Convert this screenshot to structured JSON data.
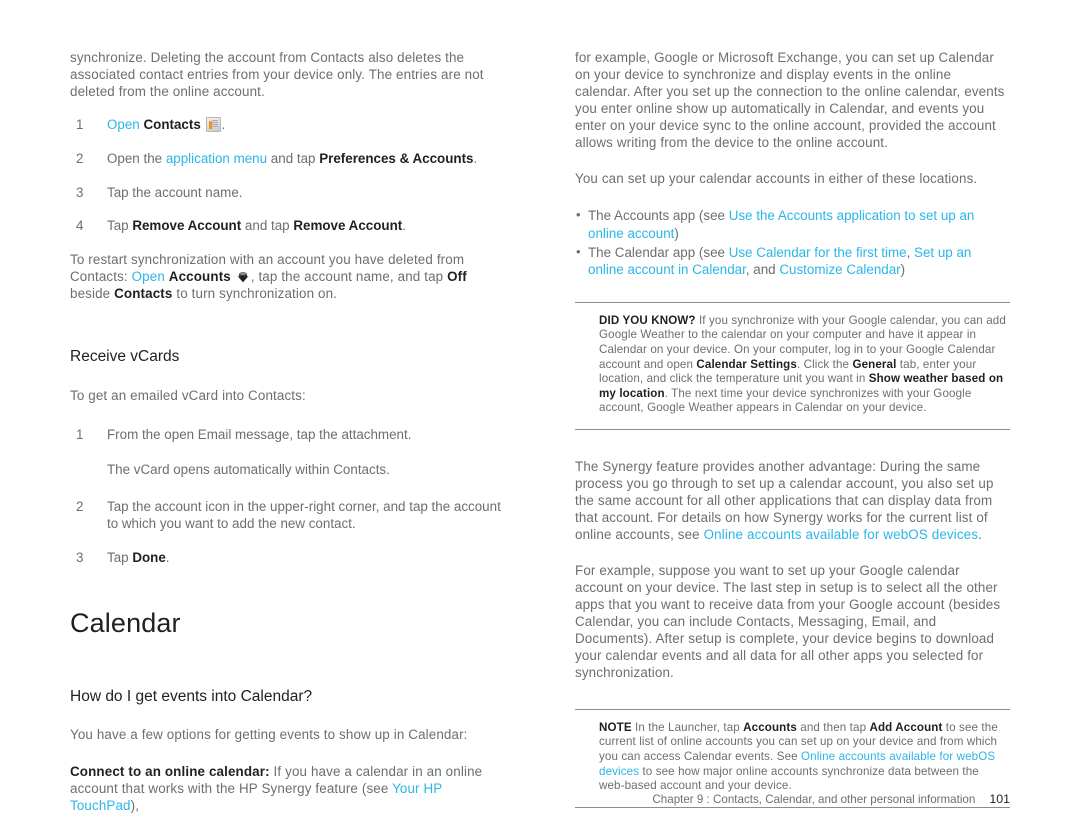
{
  "document": {
    "kind": "hp-touchpad-user-guide-page",
    "page_number": "101"
  },
  "colors": {
    "link": "#2bb6e8",
    "body_text": "#6d6e71",
    "bold_text": "#231f20",
    "icon_accent": "#f6921e",
    "rule": "#8a8c8e"
  },
  "left_column": {
    "intro_paragraph": "synchronize. Deleting the account from Contacts also deletes the associated contact entries from your device only. The entries are not deleted from the online account.",
    "remove_steps": [
      {
        "num": "1",
        "prefix_link": "Open",
        "bold": "Contacts",
        "icon": "contacts-icon",
        "suffix": "."
      },
      {
        "num": "2",
        "text_before_link": "Open the ",
        "link": "application menu",
        "text_middle": " and tap ",
        "bold": "Preferences & Accounts",
        "suffix": "."
      },
      {
        "num": "3",
        "plain": "Tap the account name."
      },
      {
        "num": "4",
        "text_before": "Tap ",
        "bold1": "Remove Account",
        "text_middle": " and tap ",
        "bold2": "Remove Account",
        "suffix": "."
      }
    ],
    "restart_paragraph": {
      "part1": "To restart synchronization with an account you have deleted from Contacts: ",
      "link": "Open",
      "part2": " ",
      "bold1": "Accounts",
      "icon": "accounts-icon",
      "part3": ", tap the account name, and tap ",
      "bold2": "Off",
      "part4": " beside ",
      "bold3": "Contacts",
      "part5": " to turn synchronization on."
    },
    "receive_vcards": {
      "heading": "Receive vCards",
      "lead": "To get an emailed vCard into Contacts:",
      "steps": [
        {
          "num": "1",
          "plain": "From the open Email message, tap the attachment."
        },
        {
          "sub": "The vCard opens automatically within Contacts."
        },
        {
          "num": "2",
          "plain": "Tap the account icon in the upper-right corner, and tap the account to which you want to add the new contact."
        },
        {
          "num": "3",
          "text_before": "Tap ",
          "bold": "Done",
          "suffix": "."
        }
      ]
    },
    "calendar_section": {
      "heading": "Calendar",
      "subheading": "How do I get events into Calendar?",
      "lead": "You have a few options for getting events to show up in Calendar:",
      "connect_para": {
        "bold_lead": "Connect to an online calendar:",
        "part1": " If you have a calendar in an online account that works with the HP Synergy feature (see ",
        "link": "Your HP TouchPad",
        "part2": "),"
      }
    }
  },
  "right_column": {
    "continued_paragraph": "for example, Google or Microsoft Exchange, you can set up Calendar on your device to synchronize and display events in the online calendar. After you set up the connection to the online calendar, events you enter online show up automatically in Calendar, and events you enter on your device sync to the online account, provided the account allows writing from the device to the online account.",
    "locations_lead": "You can set up your calendar accounts in either of these locations.",
    "location_bullets": [
      {
        "part1": "The Accounts app (see ",
        "link": "Use the Accounts application to set up an online account",
        "part2": ")"
      },
      {
        "part1": "The Calendar app (see ",
        "link1": "Use Calendar for the first time",
        "mid1": ", ",
        "link2": "Set up an online account in Calendar",
        "mid2": ", and ",
        "link3": "Customize Calendar",
        "part2": ")"
      }
    ],
    "did_you_know_callout": {
      "tag": "DID YOU KNOW?",
      "part1": " If you synchronize with your Google calendar, you can add Google Weather to the calendar on your computer and have it appear in Calendar on your device. On your computer, log in to your Google Calendar account and open ",
      "bold1": "Calendar Settings",
      "part2": ". Click the ",
      "bold2": "General",
      "part3": " tab, enter your location, and click the temperature unit you want in ",
      "bold3": "Show weather based on my location",
      "part4": ". The next time your device synchronizes with your Google account, Google Weather appears in Calendar on your device."
    },
    "synergy_paragraph": {
      "part1": "The Synergy feature provides another advantage: During the same process you go through to set up a calendar account, you also set up the same account for all other applications that can display data from that account. For details on how Synergy works for the current list of online accounts, see ",
      "link": "Online accounts available for webOS devices",
      "part2": "."
    },
    "example_paragraph": "For example, suppose you want to set up your Google calendar account on your device. The last step in setup is to select all the other apps that you want to receive data from your Google account (besides Calendar, you can include Contacts, Messaging, Email, and Documents). After setup is complete, your device begins to download your calendar events and all data for all other apps you selected for synchronization.",
    "note_callout": {
      "tag": "NOTE",
      "part1": " In the Launcher, tap ",
      "bold1": "Accounts",
      "part2": " and then tap ",
      "bold2": "Add Account",
      "part3": " to see the current list of online accounts you can set up on your device and from which you can access Calendar events. See ",
      "link": "Online accounts available for webOS devices",
      "part4": " to see how major online accounts synchronize data between the web-based account and your device."
    }
  },
  "footer": {
    "text": "Chapter 9 :  Contacts, Calendar, and other personal information",
    "page": "101"
  }
}
